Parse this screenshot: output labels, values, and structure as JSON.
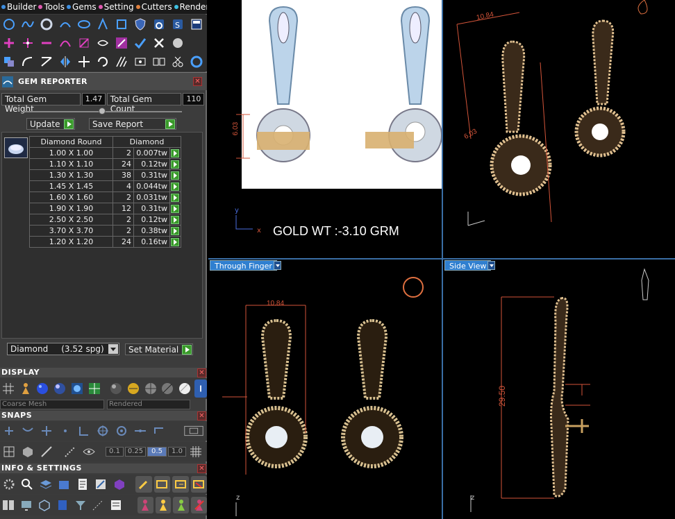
{
  "menu": {
    "items": [
      {
        "label": "Builder",
        "dot": "#3e8ee0"
      },
      {
        "label": "Tools",
        "dot": "#e05ab0"
      },
      {
        "label": "Gems",
        "dot": "#3e8ee0"
      },
      {
        "label": "Setting",
        "dot": "#e05ab0"
      },
      {
        "label": "Cutters",
        "dot": "#e0803e"
      },
      {
        "label": "Render",
        "dot": "#3ec0e0"
      }
    ]
  },
  "gem_reporter": {
    "title": "GEM REPORTER",
    "total_weight_label": "Total Gem Weight",
    "total_weight_value": "1.47",
    "total_count_label": "Total Gem Count",
    "total_count_value": "110",
    "update_label": "Update",
    "save_report_label": "Save Report",
    "table_headers": [
      "Diamond Round",
      "Diamond"
    ],
    "rows": [
      {
        "size": "1.00 X 1.00",
        "count": "2",
        "weight": "0.007tw"
      },
      {
        "size": "1.10 X 1.10",
        "count": "24",
        "weight": "0.12tw"
      },
      {
        "size": "1.30 X 1.30",
        "count": "38",
        "weight": "0.31tw"
      },
      {
        "size": "1.45 X 1.45",
        "count": "4",
        "weight": "0.044tw"
      },
      {
        "size": "1.60 X 1.60",
        "count": "2",
        "weight": "0.031tw"
      },
      {
        "size": "1.90 X 1.90",
        "count": "12",
        "weight": "0.31tw"
      },
      {
        "size": "2.50 X 2.50",
        "count": "2",
        "weight": "0.12tw"
      },
      {
        "size": "3.70 X 3.70",
        "count": "2",
        "weight": "0.38tw"
      },
      {
        "size": "1.20 X 1.20",
        "count": "24",
        "weight": "0.16tw"
      }
    ],
    "material_value": "Diamond     (3.52 spg)",
    "set_material_label": "Set Material"
  },
  "display": {
    "title": "DISPLAY",
    "mesh_value": "Coarse Mesh",
    "render_value": "Rendered"
  },
  "snaps": {
    "title": "SNAPS",
    "values": [
      "0.1",
      "0.25",
      "0.5",
      "1.0"
    ]
  },
  "info": {
    "title": "INFO & SETTINGS"
  },
  "viewports": {
    "top_left": {
      "gold_weight": "GOLD WT :-3.10 GRM",
      "dim": "6.03"
    },
    "top_right": {
      "dim1": "10.84",
      "dim2": "6.03"
    },
    "bottom_left": {
      "label": "Through Finger",
      "dim": "10.84"
    },
    "bottom_right": {
      "label": "Side View",
      "dim": "29.50"
    }
  },
  "colors": {
    "accent_blue": "#2f7fd0",
    "go_green": "#3a9a2a",
    "dimension_red": "#d4553a",
    "gold": "#d8b070"
  }
}
